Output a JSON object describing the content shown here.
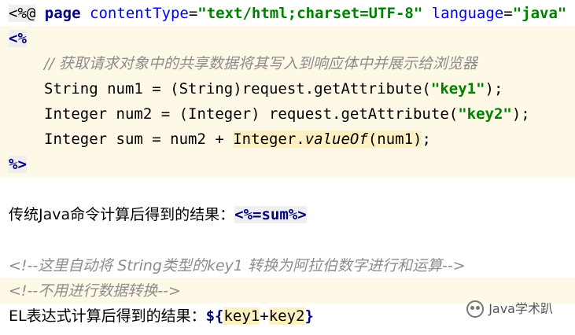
{
  "line1": {
    "open": "<%@",
    "page": "page",
    "ct_attr": "contentType",
    "eq": "=",
    "ct_val": "\"text/html;charset=UTF-8\"",
    "lang_attr": "language",
    "lang_val": "\"java\"",
    "close": "%>"
  },
  "line2": {
    "open": "<%"
  },
  "line3": {
    "comment": "// 获取请求对象中的共享数据将其写入到响应体中并展示给浏览器"
  },
  "line4": {
    "pre": "String num1 = (String)request.getAttribute(",
    "str": "\"key1\"",
    "post": ");"
  },
  "line5": {
    "pre": "Integer num2 = (Integer) request.getAttribute(",
    "str": "\"key2\"",
    "post": ");"
  },
  "line6": {
    "pre": "Integer sum = num2 + ",
    "cls": "Integer.",
    "method": "valueOf",
    "args": "(num1)",
    "post": ";"
  },
  "line7": {
    "close": "%>"
  },
  "line8": {
    "text": "传统Java命令计算后得到的结果：",
    "expr": "<%=sum%>"
  },
  "line9": {
    "comment": "<!--这里自动将 String类型的key1 转换为阿拉伯数字进行和运算-->"
  },
  "line10": {
    "comment": "<!--不用进行数据转换-->"
  },
  "line11": {
    "text": "EL表达式计算后得到的结果：",
    "el_open": "${",
    "key1": "key1",
    "plus": "+",
    "key2": "key2",
    "el_close": "}"
  },
  "watermark": {
    "icon": "wechat-icon",
    "text": "Java学术趴"
  }
}
